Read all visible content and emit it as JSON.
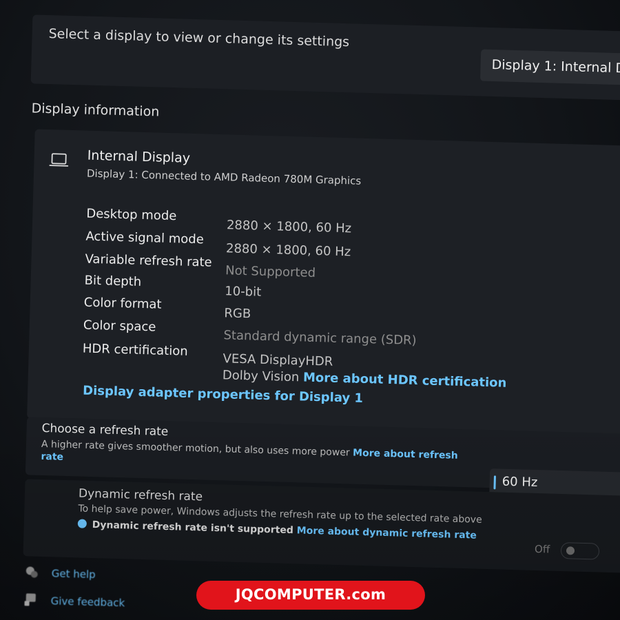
{
  "header": {
    "select_prompt": "Select a display to view or change its settings",
    "display_selector_value": "Display 1: Internal Di"
  },
  "display_information": {
    "section_title": "Display information",
    "icon": "laptop-icon",
    "display_name": "Internal Display",
    "display_subtitle": "Display 1: Connected to AMD Radeon 780M Graphics",
    "rows": [
      {
        "label": "Desktop mode",
        "value": "2880 × 1800, 60 Hz"
      },
      {
        "label": "Active signal mode",
        "value": "2880 × 1800, 60 Hz"
      },
      {
        "label": "Variable refresh rate",
        "value": "Not Supported"
      },
      {
        "label": "Bit depth",
        "value": "10-bit"
      },
      {
        "label": "Color format",
        "value": "RGB"
      },
      {
        "label": "Color space",
        "value": "Standard dynamic range (SDR)"
      },
      {
        "label": "HDR certification",
        "value": "VESA DisplayHDR",
        "value2": "Dolby Vision",
        "link": "More about HDR certification"
      }
    ],
    "adapter_link": "Display adapter properties for Display 1"
  },
  "refresh_rate": {
    "title": "Choose a refresh rate",
    "description": "A higher rate gives smoother motion, but also uses more power",
    "link": "More about refresh rate",
    "selected": "60 Hz"
  },
  "dynamic_refresh": {
    "title": "Dynamic refresh rate",
    "description": "To help save power, Windows adjusts the refresh rate up to the selected rate above",
    "note": "Dynamic refresh rate isn't supported",
    "note_link": "More about dynamic refresh rate",
    "toggle_label": "Off",
    "toggle_state": "off"
  },
  "footer": {
    "get_help": "Get help",
    "give_feedback": "Give feedback"
  },
  "watermark": {
    "text": "JQCOMPUTER.com",
    "color": "#e1141b"
  },
  "colors": {
    "accent": "#6cc6ff",
    "background": "#121519",
    "card": "#1d2025"
  }
}
